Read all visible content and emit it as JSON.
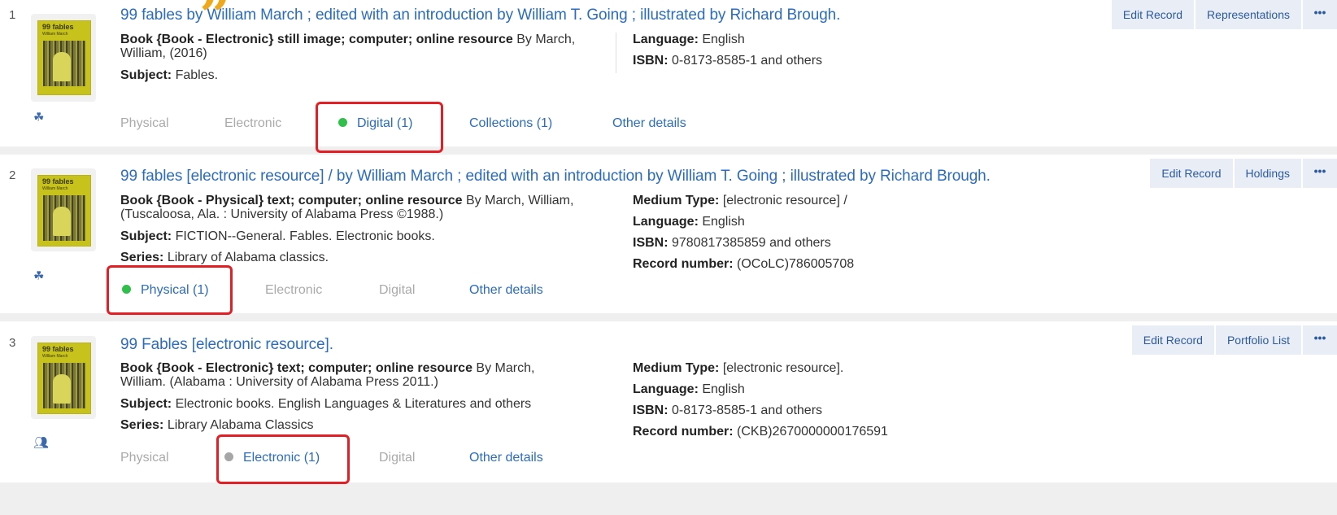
{
  "records": [
    {
      "num": "1",
      "cover_title": "99 fables",
      "cover_sub": "William March",
      "title": "99 fables by William March ; edited with an introduction by William T. Going ; illustrated by Richard Brough.",
      "type_line_bold": "Book {Book - Electronic} still image; computer; online resource",
      "type_line_rest": " By March,",
      "type_line_2": "William, (2016)",
      "subject_label": "Subject:",
      "subject": " Fables.",
      "series_label": "",
      "series": "",
      "side": [
        {
          "label": "Language:",
          "value": " English"
        },
        {
          "label": "ISBN:",
          "value": " 0-8173-8585-1 and others"
        }
      ],
      "tabs": [
        {
          "label": "Physical",
          "active": false
        },
        {
          "label": "Electronic",
          "active": false
        },
        {
          "label": "Digital (1)",
          "active": true,
          "dot": "green"
        },
        {
          "label": "Collections (1)",
          "active": true
        },
        {
          "label": "Other details",
          "active": true
        }
      ],
      "buttons": [
        "Edit Record",
        "Representations"
      ],
      "more": "•••",
      "type_icon": "hierarchy-icon"
    },
    {
      "num": "2",
      "cover_title": "99 fables",
      "cover_sub": "William March",
      "title": "99 fables [electronic resource] / by William March ; edited with an introduction by William T. Going ; illustrated by Richard Brough.",
      "type_line_bold": "Book {Book - Physical} text; computer; online resource",
      "type_line_rest": " By March, William,",
      "type_line_2": "(Tuscaloosa, Ala. : University of Alabama Press ©1988.)",
      "subject_label": "Subject:",
      "subject": " FICTION--General. Fables. Electronic books.",
      "series_label": "Series:",
      "series": " Library of Alabama classics.",
      "side": [
        {
          "label": "Medium Type:",
          "value": " [electronic resource] /"
        },
        {
          "label": "Language:",
          "value": " English"
        },
        {
          "label": "ISBN:",
          "value": " 9780817385859 and others"
        },
        {
          "label": "Record number:",
          "value": " (OCoLC)786005708"
        }
      ],
      "tabs": [
        {
          "label": "Physical (1)",
          "active": true,
          "dot": "green"
        },
        {
          "label": "Electronic",
          "active": false
        },
        {
          "label": "Digital",
          "active": false
        },
        {
          "label": "Other details",
          "active": true
        }
      ],
      "buttons": [
        "Edit Record",
        "Holdings"
      ],
      "more": "•••",
      "type_icon": "hierarchy-icon"
    },
    {
      "num": "3",
      "cover_title": "99 fables",
      "cover_sub": "William March",
      "title": "99 Fables [electronic resource].",
      "type_line_bold": "Book {Book - Electronic} text; computer; online resource",
      "type_line_rest": " By March,",
      "type_line_2": "William. (Alabama : University of Alabama Press 2011.)",
      "subject_label": "Subject:",
      "subject": " Electronic books. English Languages & Literatures and others",
      "series_label": "Series:",
      "series": " Library Alabama Classics",
      "side": [
        {
          "label": "Medium Type:",
          "value": " [electronic resource]."
        },
        {
          "label": "Language:",
          "value": " English"
        },
        {
          "label": "ISBN:",
          "value": " 0-8173-8585-1 and others"
        },
        {
          "label": "Record number:",
          "value": " (CKB)2670000000176591"
        }
      ],
      "tabs": [
        {
          "label": "Physical",
          "active": false
        },
        {
          "label": "Electronic (1)",
          "active": true,
          "dot": "grey"
        },
        {
          "label": "Digital",
          "active": false
        },
        {
          "label": "Other details",
          "active": true
        }
      ],
      "buttons": [
        "Edit Record",
        "Portfolio List"
      ],
      "more": "•••",
      "type_icon": "users-icon"
    }
  ],
  "colors": {
    "accent": "#2b6cbe",
    "highlight": "#e31e24",
    "available": "#2fbf4a",
    "unavailable": "#a6a6a6",
    "quote": "#f0a81b"
  }
}
